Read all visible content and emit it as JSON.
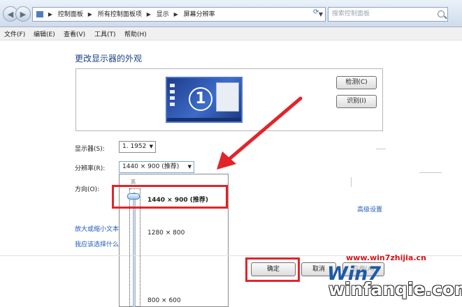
{
  "address_bar": {
    "crumbs": [
      "控制面板",
      "所有控制面板项",
      "显示",
      "屏幕分辨率"
    ],
    "search_placeholder": "搜索控制面板"
  },
  "menu": [
    "文件(F)",
    "编辑(E)",
    "查看(V)",
    "工具(T)",
    "帮助(H)"
  ],
  "page_title": "更改显示器的外观",
  "preview": {
    "monitor_number": "1",
    "detect_button": "检测(C)",
    "identify_button": "识别(I)"
  },
  "settings": {
    "display_label": "显示器(S):",
    "display_value": "1. 1952",
    "resolution_label": "分辨率(R):",
    "resolution_value": "1440 × 900 (推荐)",
    "orientation_label": "方向(O):"
  },
  "resolution_dropdown": {
    "top_label": "高",
    "options": [
      "1440 × 900 (推荐)",
      "1280 × 800",
      "800 × 600"
    ],
    "selected_index": 0
  },
  "links": {
    "advanced": "高级设置",
    "text_size": "放大或缩小文本",
    "choose": "我应该选择什么"
  },
  "buttons": {
    "ok": "确定",
    "cancel": "取消",
    "apply": "应用(A)"
  },
  "watermark": {
    "url": "www.win7zhijia.cn",
    "logo": "Win7",
    "text": "winfanqie.com"
  },
  "colors": {
    "highlight": "#e2242a",
    "link": "#1f5bb8",
    "title": "#1f3f8a"
  }
}
